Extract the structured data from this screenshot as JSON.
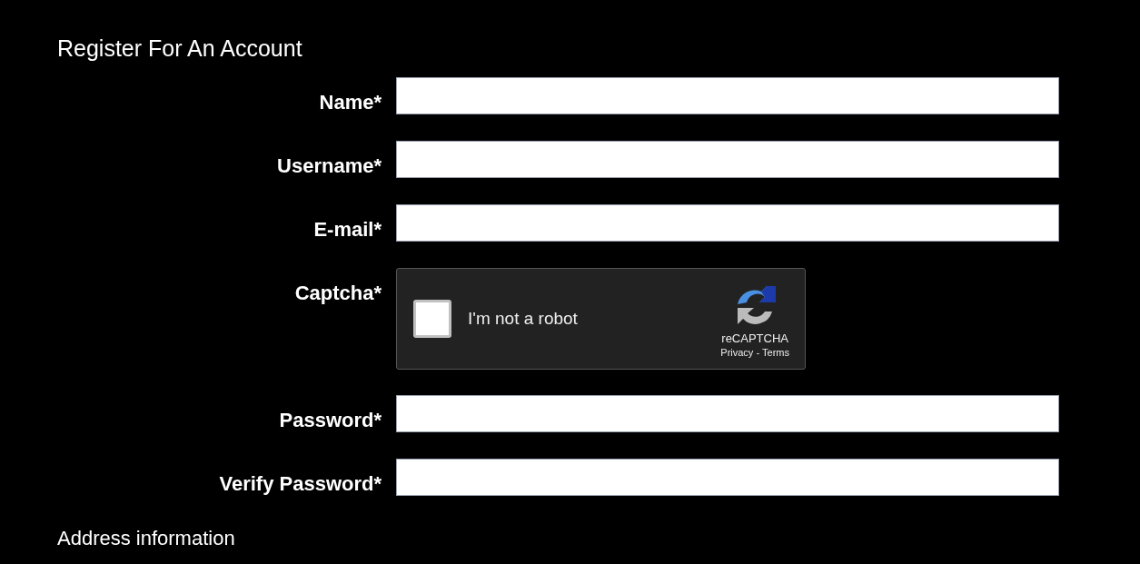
{
  "title": "Register For An Account",
  "fields": [
    {
      "kind": "text",
      "label": "Name*"
    },
    {
      "kind": "text",
      "label": "Username*"
    },
    {
      "kind": "text",
      "label": "E-mail*"
    },
    {
      "kind": "captcha",
      "label": "Captcha*",
      "checked": false,
      "text": "I'm not a robot",
      "brand": "reCAPTCHA",
      "privacy": "Privacy",
      "separator": "-",
      "terms": "Terms"
    },
    {
      "kind": "password",
      "label": "Password*"
    },
    {
      "kind": "password",
      "label": "Verify Password*"
    }
  ],
  "section": "Address information"
}
